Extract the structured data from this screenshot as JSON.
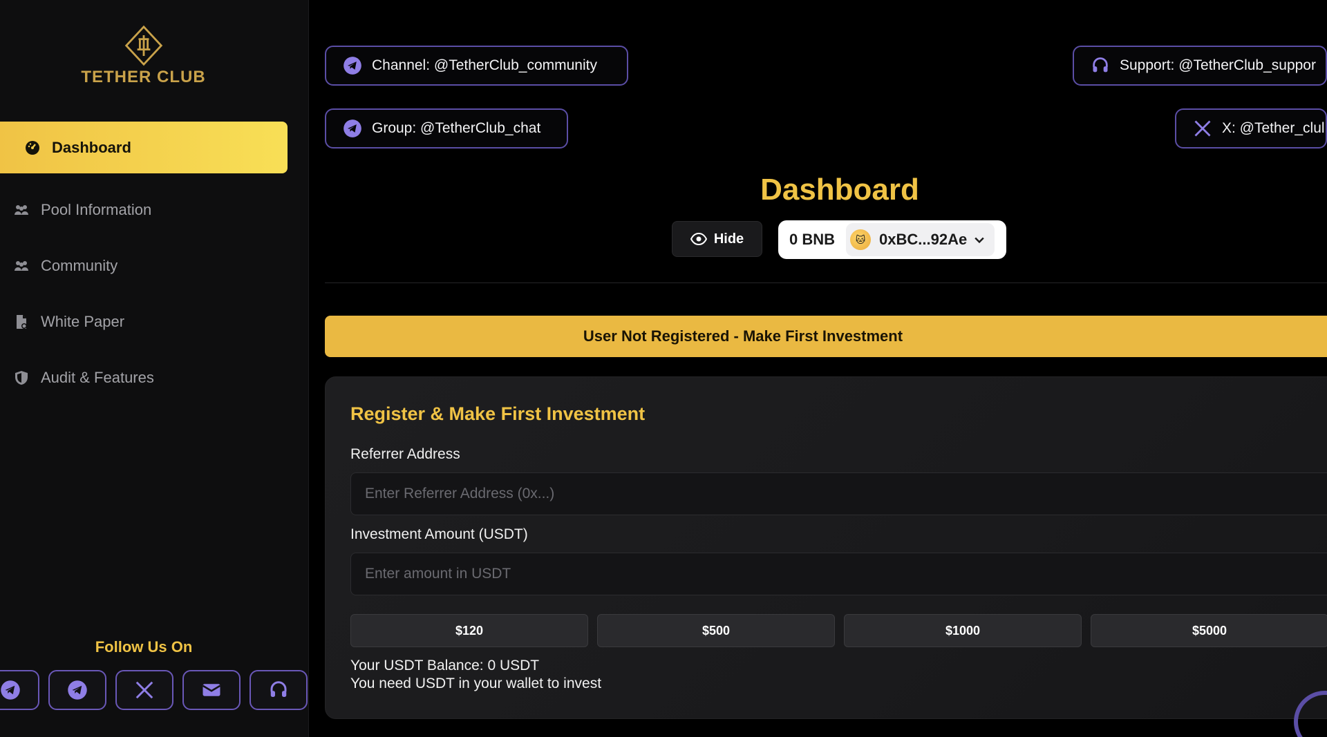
{
  "sidebar": {
    "logo_text": "TETHER CLUB",
    "nav": [
      {
        "label": "Dashboard",
        "icon": "gauge-icon",
        "active": true
      },
      {
        "label": "Pool Information",
        "icon": "users-icon",
        "active": false
      },
      {
        "label": "Community",
        "icon": "users-icon",
        "active": false
      },
      {
        "label": "White Paper",
        "icon": "document-icon",
        "active": false
      },
      {
        "label": "Audit & Features",
        "icon": "shield-icon",
        "active": false
      }
    ],
    "follow_title": "Follow Us On",
    "socials": [
      "telegram-icon",
      "telegram-icon",
      "x-icon",
      "mail-icon",
      "headset-icon"
    ]
  },
  "links": {
    "channel": "Channel: @TetherClub_community",
    "group": "Group: @TetherClub_chat",
    "support": "Support: @TetherClub_suppor",
    "x": "X: @Tether_clul"
  },
  "header": {
    "title": "Dashboard",
    "hide_label": "Hide",
    "wallet_balance": "0 BNB",
    "wallet_address": "0xBC...92Ae"
  },
  "banner": "User Not Registered - Make First Investment",
  "form": {
    "title": "Register & Make First Investment",
    "referrer_label": "Referrer Address",
    "referrer_placeholder": "Enter Referrer Address (0x...)",
    "amount_label": "Investment Amount (USDT)",
    "amount_placeholder": "Enter amount in USDT",
    "presets": [
      "$120",
      "$500",
      "$1000",
      "$5000"
    ],
    "balance_text": "Your USDT Balance: 0 USDT",
    "hint_text": "You need USDT in your wallet to invest"
  },
  "colors": {
    "accent": "#f0c345",
    "purple": "#5b4ea6",
    "background": "#000000"
  }
}
